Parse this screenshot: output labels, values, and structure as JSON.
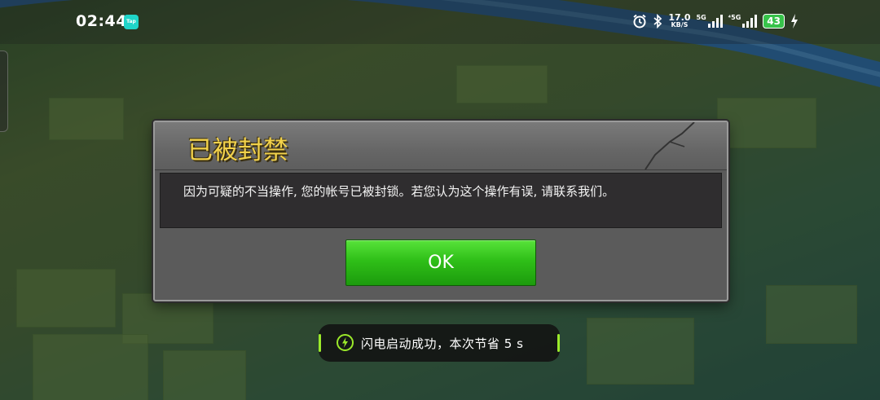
{
  "status_bar": {
    "time": "02:44",
    "notification_badge": "Tap",
    "network_speed": "17.0",
    "network_speed_unit": "KB/S",
    "sim1_label": "5G",
    "sim2_label": "⁴5G",
    "battery_level": "43"
  },
  "dialog": {
    "title": "已被封禁",
    "message": "因为可疑的不当操作, 您的帐号已被封锁。若您认为这个操作有误, 请联系我们。",
    "ok_label": "OK"
  },
  "toast": {
    "text": "闪电启动成功，本次节省 5 s"
  },
  "colors": {
    "title_gold": "#f2d24b",
    "ok_green": "#2fbf18",
    "toast_accent": "#9bea2a"
  }
}
